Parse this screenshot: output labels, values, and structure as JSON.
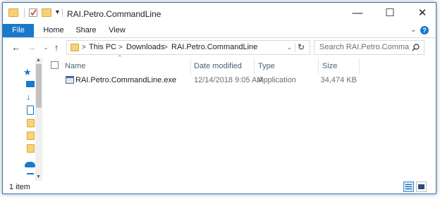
{
  "window": {
    "title": "RAI.Petro.CommandLine",
    "minimize_glyph": "—",
    "maximize_glyph": "☐",
    "close_glyph": "✕"
  },
  "ribbon": {
    "tabs": [
      "File",
      "Home",
      "Share",
      "View"
    ],
    "help": "?"
  },
  "address": {
    "crumbs": [
      "This PC",
      "Downloads",
      "RAI.Petro.CommandLine"
    ],
    "separator": ">"
  },
  "search": {
    "placeholder": "Search RAI.Petro.CommandLi..."
  },
  "columns": [
    "Name",
    "Date modified",
    "Type",
    "Size"
  ],
  "files": [
    {
      "name": "RAI.Petro.CommandLine.exe",
      "date_modified": "12/14/2018 9:05 AM",
      "type": "Application",
      "size": "34,474 KB",
      "icon": "application-icon"
    }
  ],
  "status": {
    "item_count": "1 item"
  },
  "colors": {
    "accent": "#1979ca",
    "folder": "#f7d374",
    "header_text": "#4c607a"
  }
}
